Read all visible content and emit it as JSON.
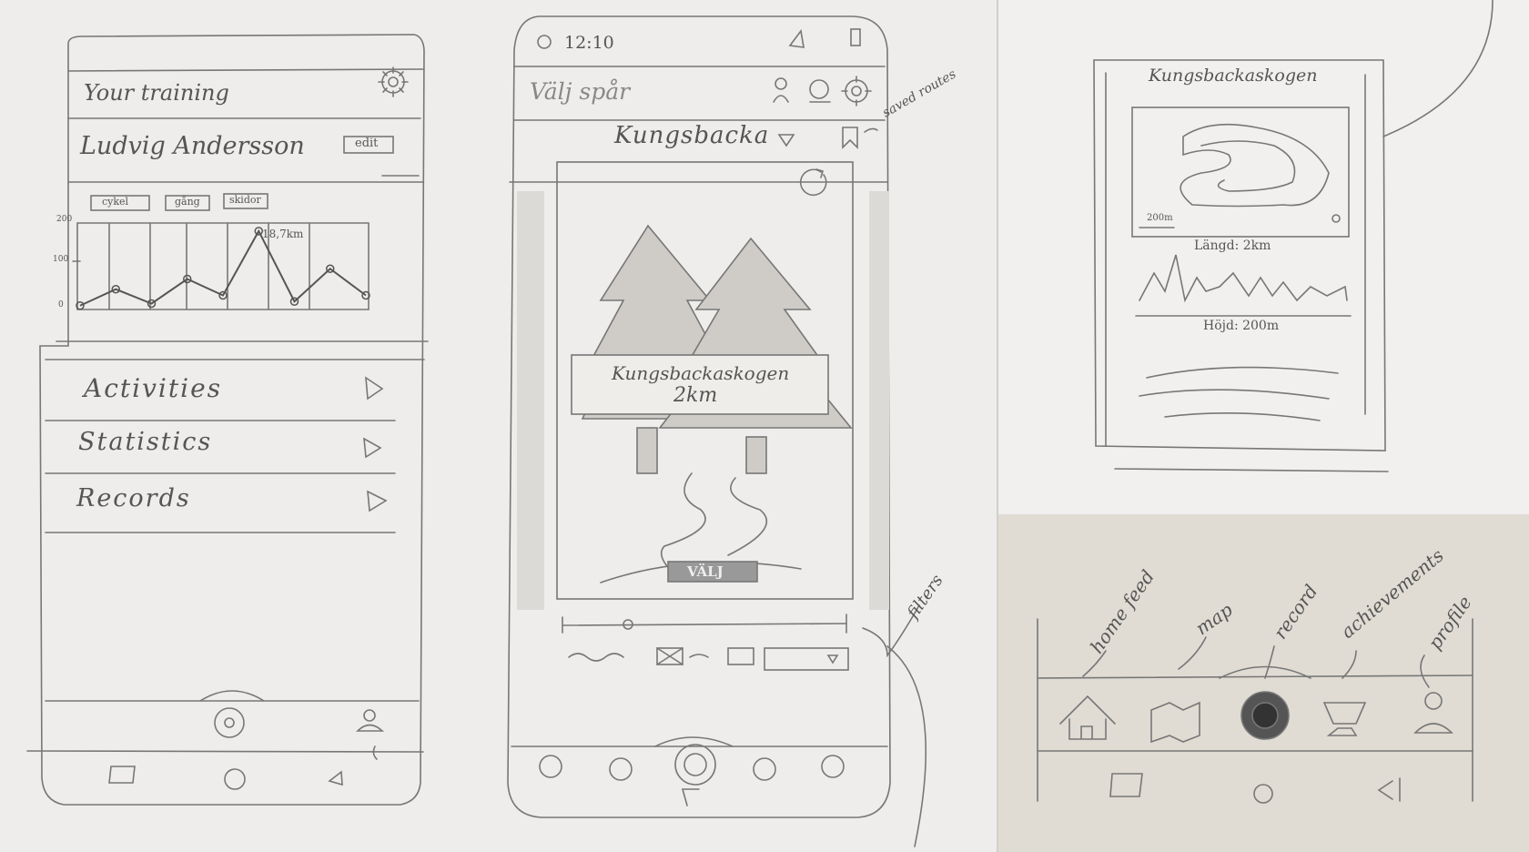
{
  "left_phone": {
    "title": "Your training",
    "user_name": "Ludvig Andersson",
    "edit_label": "edit",
    "chart_tabs": [
      "cykel",
      "gång",
      "skidor"
    ],
    "y_ticks": [
      "200",
      "100",
      "0"
    ],
    "peak_label": "18,7km",
    "menu": [
      {
        "label": "Activities"
      },
      {
        "label": "Statistics"
      },
      {
        "label": "Records"
      }
    ]
  },
  "mid_phone": {
    "status_time": "12:10",
    "header_title": "Välj spår",
    "location_dropdown": "Kungsbacka",
    "card_title": "Kungsbackaskogen",
    "card_distance": "2km",
    "select_button": "VÄLJ",
    "annotations": {
      "saved_routes": "saved routes",
      "filters": "filters"
    }
  },
  "detail_card": {
    "title": "Kungsbackaskogen",
    "scale_label": "200m",
    "length_label": "Längd: 2km",
    "height_label": "Höjd: 200m"
  },
  "nav_bar": {
    "labels": [
      "home feed",
      "map",
      "record",
      "achievements",
      "profile"
    ]
  },
  "chart_data": {
    "type": "line",
    "x": [
      1,
      2,
      3,
      4,
      5,
      6,
      7,
      8,
      9
    ],
    "values": [
      5,
      45,
      10,
      70,
      30,
      187,
      15,
      95,
      30
    ],
    "ylim": [
      0,
      200
    ],
    "annotations": [
      "18,7km"
    ]
  }
}
